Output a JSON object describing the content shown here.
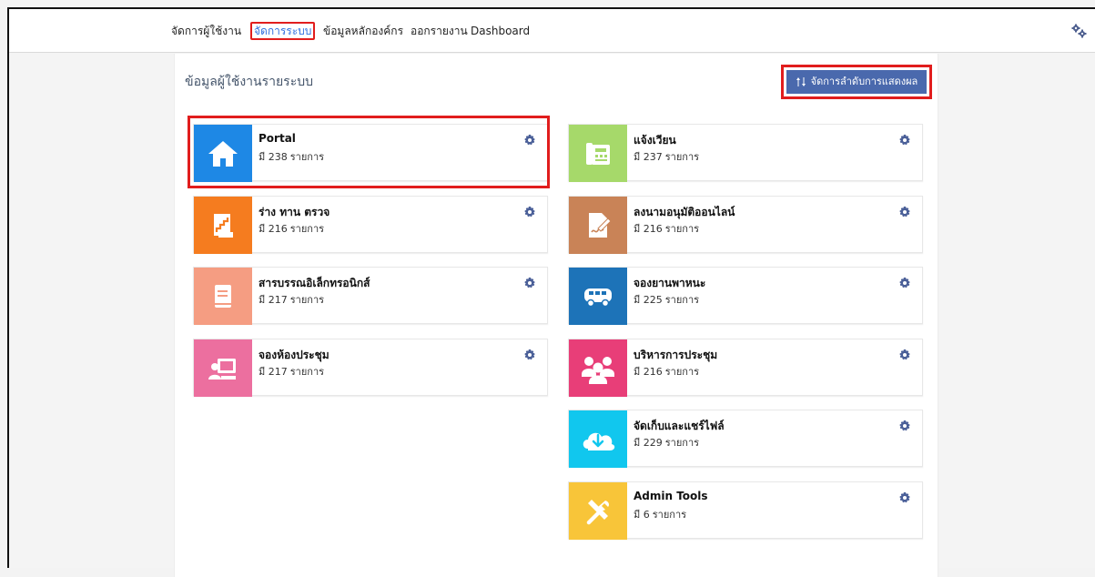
{
  "nav": {
    "items": [
      {
        "label": "จัดการผู้ใช้งาน"
      },
      {
        "label": "จัดการระบบ",
        "active": true
      },
      {
        "label": "ข้อมูลหลักองค์กร"
      },
      {
        "label": "ออกรายงาน"
      },
      {
        "label": "Dashboard"
      }
    ],
    "settings_icon": "gears-icon"
  },
  "page": {
    "title": "ข้อมูลผู้ใช้งานรายระบบ",
    "sort_button": "จัดการลำดับการแสดงผล",
    "sort_icon": "sort-arrows-icon"
  },
  "cards": [
    {
      "title": "Portal",
      "count_prefix": "มี 238",
      "count_suffix": "รายการ",
      "icon": "home-icon",
      "color": "#1e88e5"
    },
    {
      "title": "แจ้งเวียน",
      "count_prefix": "มี 237",
      "count_suffix": "รายการ",
      "icon": "fax-icon",
      "color": "#a6d96a"
    },
    {
      "title": "ร่าง ทาน ตรวจ",
      "count_prefix": "มี 216",
      "count_suffix": "รายการ",
      "icon": "stairs-document-icon",
      "color": "#f57c1f"
    },
    {
      "title": "ลงนามอนุมัติออนไลน์",
      "count_prefix": "มี 216",
      "count_suffix": "รายการ",
      "icon": "signature-icon",
      "color": "#c98357"
    },
    {
      "title": "สารบรรณอิเล็กทรอนิกส์",
      "count_prefix": "มี 217",
      "count_suffix": "รายการ",
      "icon": "book-icon",
      "color": "#f59d82"
    },
    {
      "title": "จองยานพาหนะ",
      "count_prefix": "มี 225",
      "count_suffix": "รายการ",
      "icon": "bus-icon",
      "color": "#1d73b8"
    },
    {
      "title": "จองห้องประชุม",
      "count_prefix": "มี 217",
      "count_suffix": "รายการ",
      "icon": "presentation-icon",
      "color": "#ec6f9f"
    },
    {
      "title": "บริหารการประชุม",
      "count_prefix": "มี 216",
      "count_suffix": "รายการ",
      "icon": "users-icon",
      "color": "#e83e78"
    },
    {
      "title": "จัดเก็บและแชร์ไฟล์",
      "count_prefix": "มี 229",
      "count_suffix": "รายการ",
      "icon": "cloud-download-icon",
      "color": "#11c7ee"
    },
    {
      "title": "Admin Tools",
      "count_prefix": "มี 6",
      "count_suffix": "รายการ",
      "icon": "tools-icon",
      "color": "#f8c539"
    }
  ],
  "colors": {
    "accent": "#2f6fdf",
    "button": "#4a69ad",
    "highlight": "#e11d1d",
    "gear": "#4a5f98"
  }
}
